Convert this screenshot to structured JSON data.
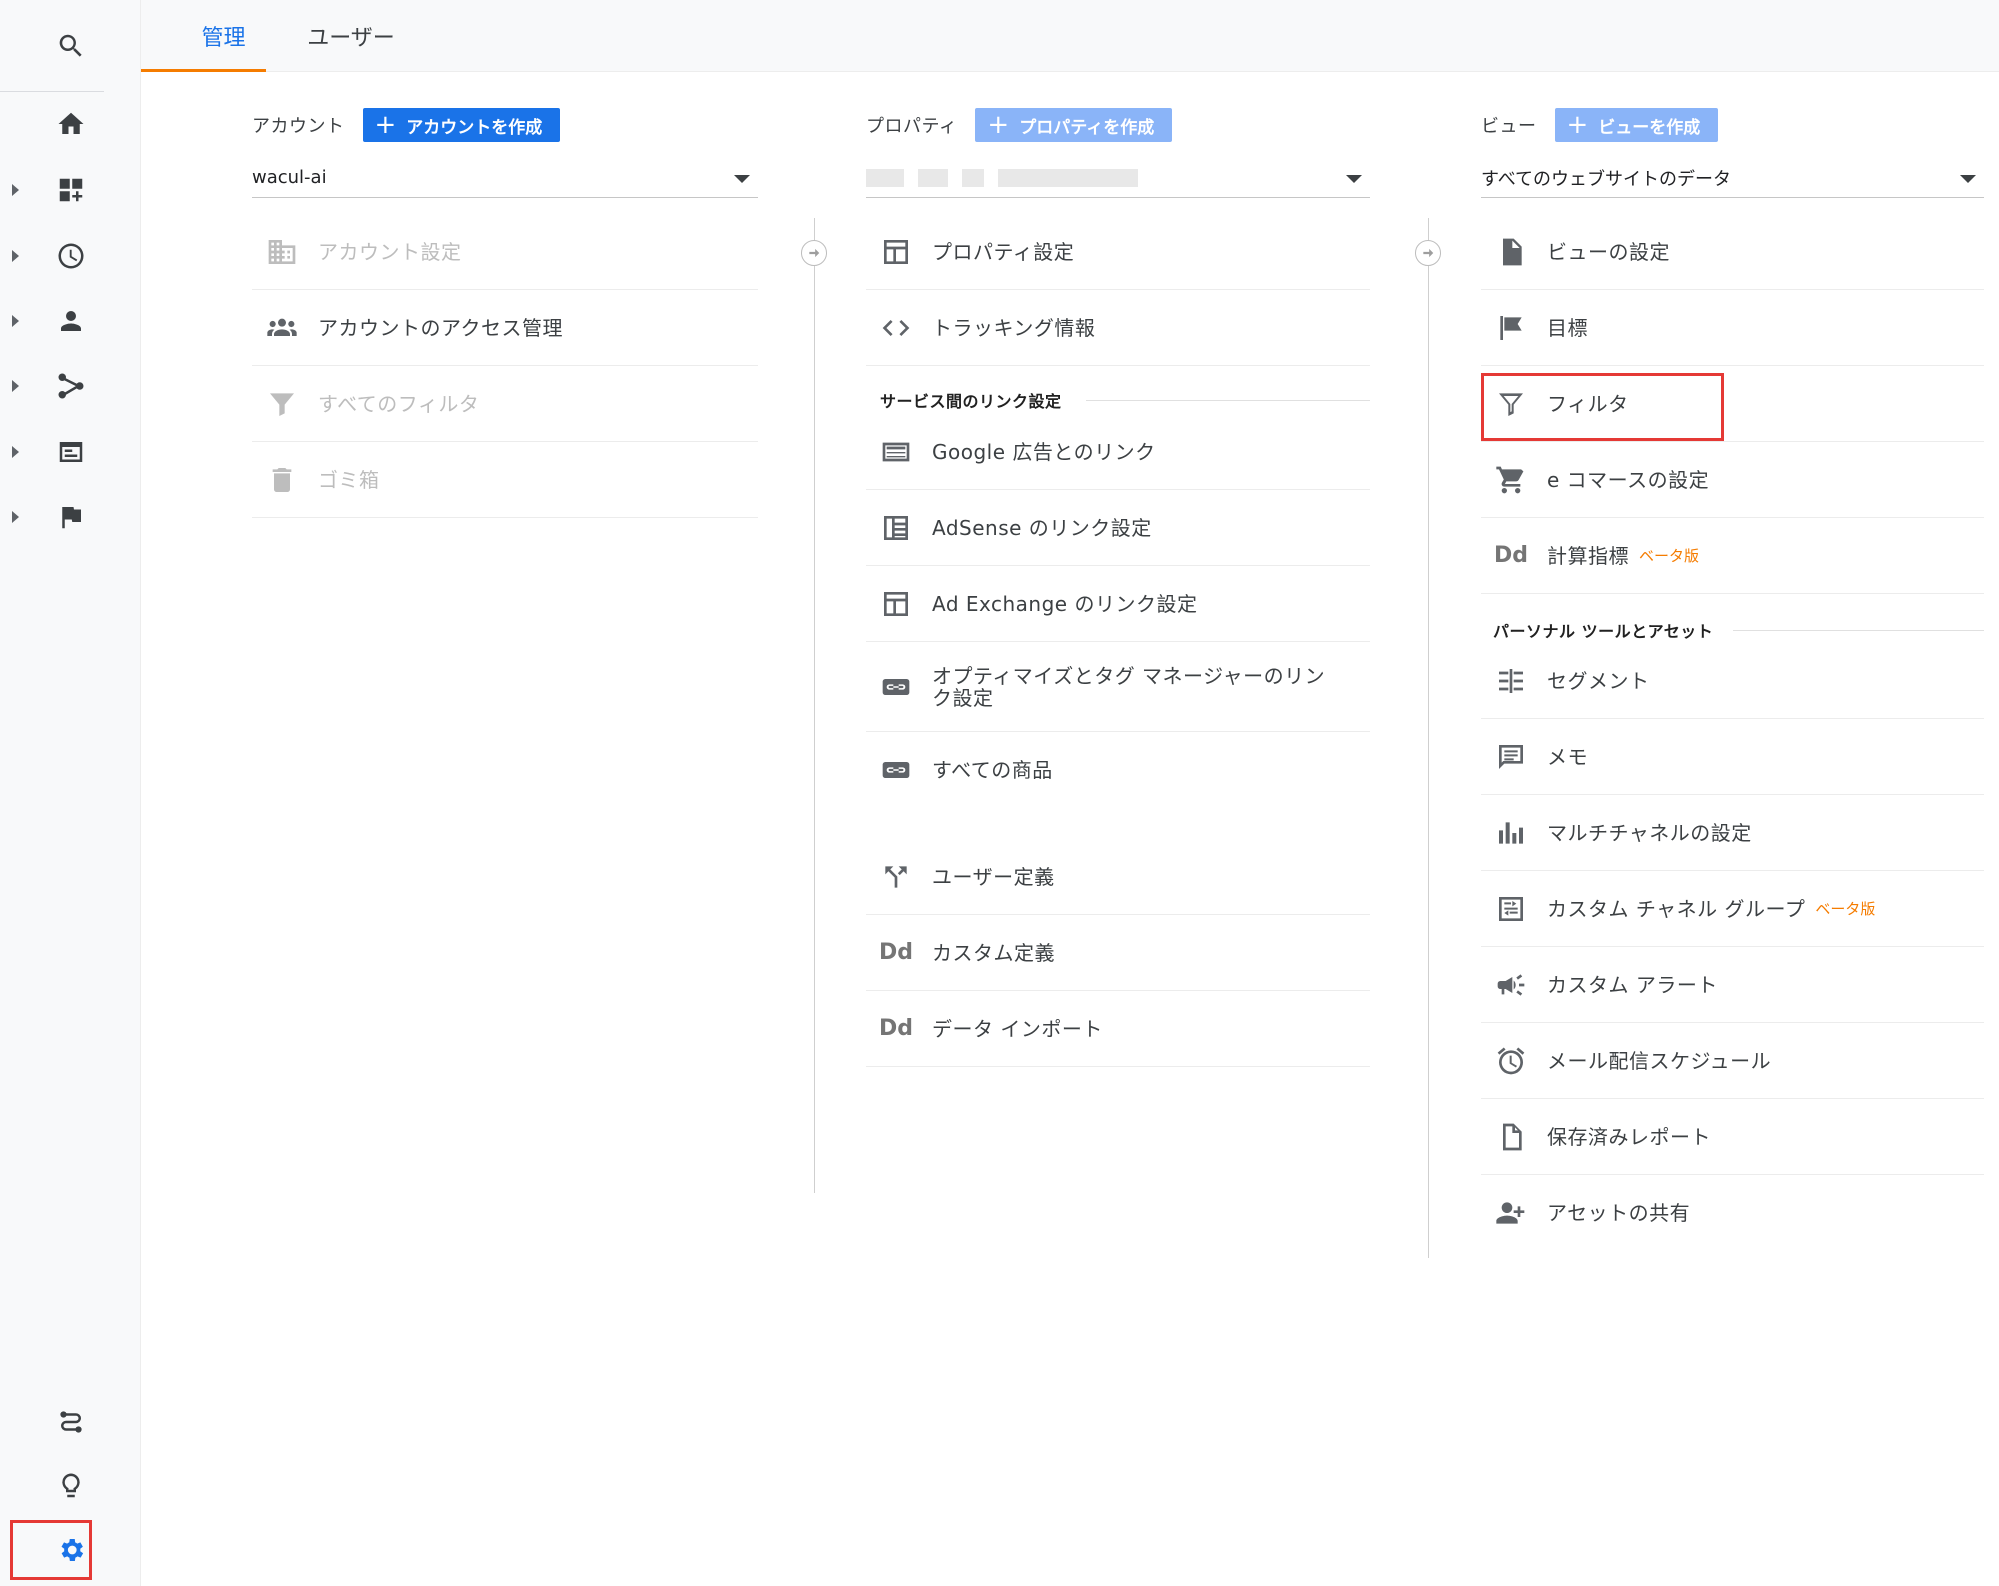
{
  "tabs": [
    {
      "label": "管理",
      "active": true
    },
    {
      "label": "ユーザー",
      "active": false
    }
  ],
  "left_nav": {
    "icons": [
      "search-icon",
      "home-icon",
      "customization-icon",
      "realtime-icon",
      "audience-icon",
      "acquisition-icon",
      "behavior-icon",
      "conversions-icon",
      "attribution-icon",
      "discover-icon",
      "admin-gear-icon"
    ],
    "highlighted": "admin-gear-icon"
  },
  "account": {
    "label": "アカウント",
    "create_button": "アカウントを作成",
    "selected": "wacul-ai",
    "items": [
      {
        "label": "アカウント設定",
        "icon": "building-icon",
        "disabled": true
      },
      {
        "label": "アカウントのアクセス管理",
        "icon": "people-icon",
        "disabled": false
      },
      {
        "label": "すべてのフィルタ",
        "icon": "filter-icon",
        "disabled": true
      },
      {
        "label": "ゴミ箱",
        "icon": "trash-icon",
        "disabled": true
      }
    ]
  },
  "property": {
    "label": "プロパティ",
    "create_button": "プロパティを作成",
    "items_top": [
      {
        "label": "プロパティ設定",
        "icon": "window-icon"
      },
      {
        "label": "トラッキング情報",
        "icon": "code-icon"
      }
    ],
    "section_title": "サービス間のリンク設定",
    "items_links": [
      {
        "label": "Google 広告とのリンク",
        "icon": "ads-icon"
      },
      {
        "label": "AdSense のリンク設定",
        "icon": "adsense-icon"
      },
      {
        "label": "Ad Exchange のリンク設定",
        "icon": "window-icon"
      },
      {
        "label": "オプティマイズとタグ マネージャーのリンク設定",
        "icon": "link-icon"
      },
      {
        "label": "すべての商品",
        "icon": "link-icon"
      }
    ],
    "items_bottom": [
      {
        "label": "ユーザー定義",
        "icon": "fork-icon"
      },
      {
        "label": "カスタム定義",
        "icon": "dd-icon"
      },
      {
        "label": "データ インポート",
        "icon": "dd-icon"
      }
    ]
  },
  "view": {
    "label": "ビュー",
    "create_button": "ビューを作成",
    "selected": "すべてのウェブサイトのデータ",
    "items_top": [
      {
        "label": "ビューの設定",
        "icon": "document-icon"
      },
      {
        "label": "目標",
        "icon": "flag-icon"
      },
      {
        "label": "フィルタ",
        "icon": "filter-icon"
      },
      {
        "label": "e コマースの設定",
        "icon": "cart-icon"
      },
      {
        "label": "計算指標",
        "icon": "dd-icon",
        "badge": "ベータ版"
      }
    ],
    "section_title": "パーソナル ツールとアセット",
    "items_personal": [
      {
        "label": "セグメント",
        "icon": "segment-icon"
      },
      {
        "label": "メモ",
        "icon": "comment-icon"
      },
      {
        "label": "マルチチャネルの設定",
        "icon": "bar-chart-icon"
      },
      {
        "label": "カスタム チャネル グループ",
        "icon": "channel-group-icon",
        "badge": "ベータ版"
      },
      {
        "label": "カスタム アラート",
        "icon": "megaphone-icon"
      },
      {
        "label": "メール配信スケジュール",
        "icon": "alarm-icon"
      },
      {
        "label": "保存済みレポート",
        "icon": "file-icon"
      },
      {
        "label": "アセットの共有",
        "icon": "person-add-icon"
      }
    ]
  },
  "highlight_color": "#e53935",
  "accent_color": "#1a73e8"
}
